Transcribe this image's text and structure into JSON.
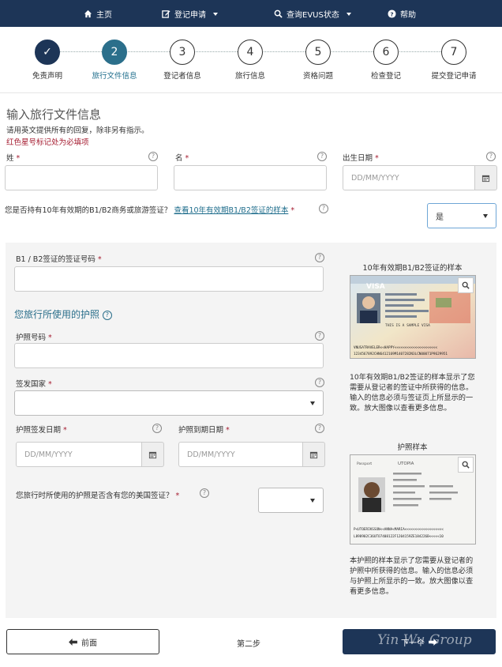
{
  "nav": {
    "home": "主页",
    "register": "登记申请",
    "status": "查询EVUS状态",
    "help": "帮助"
  },
  "steps": [
    {
      "num": "✓",
      "label": "免责声明",
      "state": "done"
    },
    {
      "num": "2",
      "label": "旅行文件信息",
      "state": "active"
    },
    {
      "num": "3",
      "label": "登记者信息",
      "state": "todo"
    },
    {
      "num": "4",
      "label": "旅行信息",
      "state": "todo"
    },
    {
      "num": "5",
      "label": "资格问题",
      "state": "todo"
    },
    {
      "num": "6",
      "label": "检查登记",
      "state": "todo"
    },
    {
      "num": "7",
      "label": "提交登记申请",
      "state": "todo"
    }
  ],
  "page": {
    "title": "输入旅行文件信息",
    "instruction": "请用英文提供所有的回复，除非另有指示。",
    "required_note": "红色星号标记处为必填项"
  },
  "fields": {
    "surname_label": "姓",
    "given_label": "名",
    "dob_label": "出生日期",
    "dob_placeholder": "DD/MM/YYYY",
    "visa_question": "您是否持有10年有效期的B1/B2商务或旅游签证？",
    "visa_sample_link": "查看10年有效期B1/B2签证的样本",
    "visa_answer": "是",
    "visa_number_label": "B1 / B2签证的签证号码",
    "passport_section": "您旅行所使用的护照",
    "passport_number_label": "护照号码",
    "issuing_country_label": "签发国家",
    "issuing_country_value": "",
    "issue_date_label": "护照签发日期",
    "issue_date_placeholder": "DD/MM/YYYY",
    "expiry_date_label": "护照到期日期",
    "expiry_date_placeholder": "DD/MM/YYYY",
    "contains_visa_question": "您旅行时所使用的护照是否含有您的美国签证？",
    "contains_visa_value": "",
    "star": "*",
    "help_mark": "?"
  },
  "visa_sample": {
    "title": "10年有效期B1/B2签证的样本",
    "desc": "10年有效期B1/B2签证的样本显示了您需要从登记者的签证中所获得的信息。输入的信息必须与签证页上所显示的一致。放大图像以查看更多信息。",
    "label_visa": "VISA",
    "label_sample": "THIS IS A SAMPLE VISA",
    "mrz1": "VNUSATRAVELER<<HAPPY<<<<<<<<<<<<<<<<<<<<<",
    "mrz2": "1234567892CHN6412169M1407282N3LCN00071P9629951"
  },
  "passport_sample": {
    "title": "护照样本",
    "desc": "本护照的样本显示了您需要从登记者的护照中所获得的信息。输入的信息必须与护照上所显示的一致。放大图像以查看更多信息。",
    "label_country": "UTOPIA",
    "label_passport": "Passport",
    "mrz1": "P<UTOERIKSSON<<ANNA<MARIA<<<<<<<<<<<<<<<<<<<",
    "mrz2": "L898902C36UTO7408122F1204159ZE184226B<<<<<10"
  },
  "footer": {
    "back": "前面",
    "step": "第二步",
    "next": "下一个",
    "watermark": "Yin Wu Group"
  }
}
